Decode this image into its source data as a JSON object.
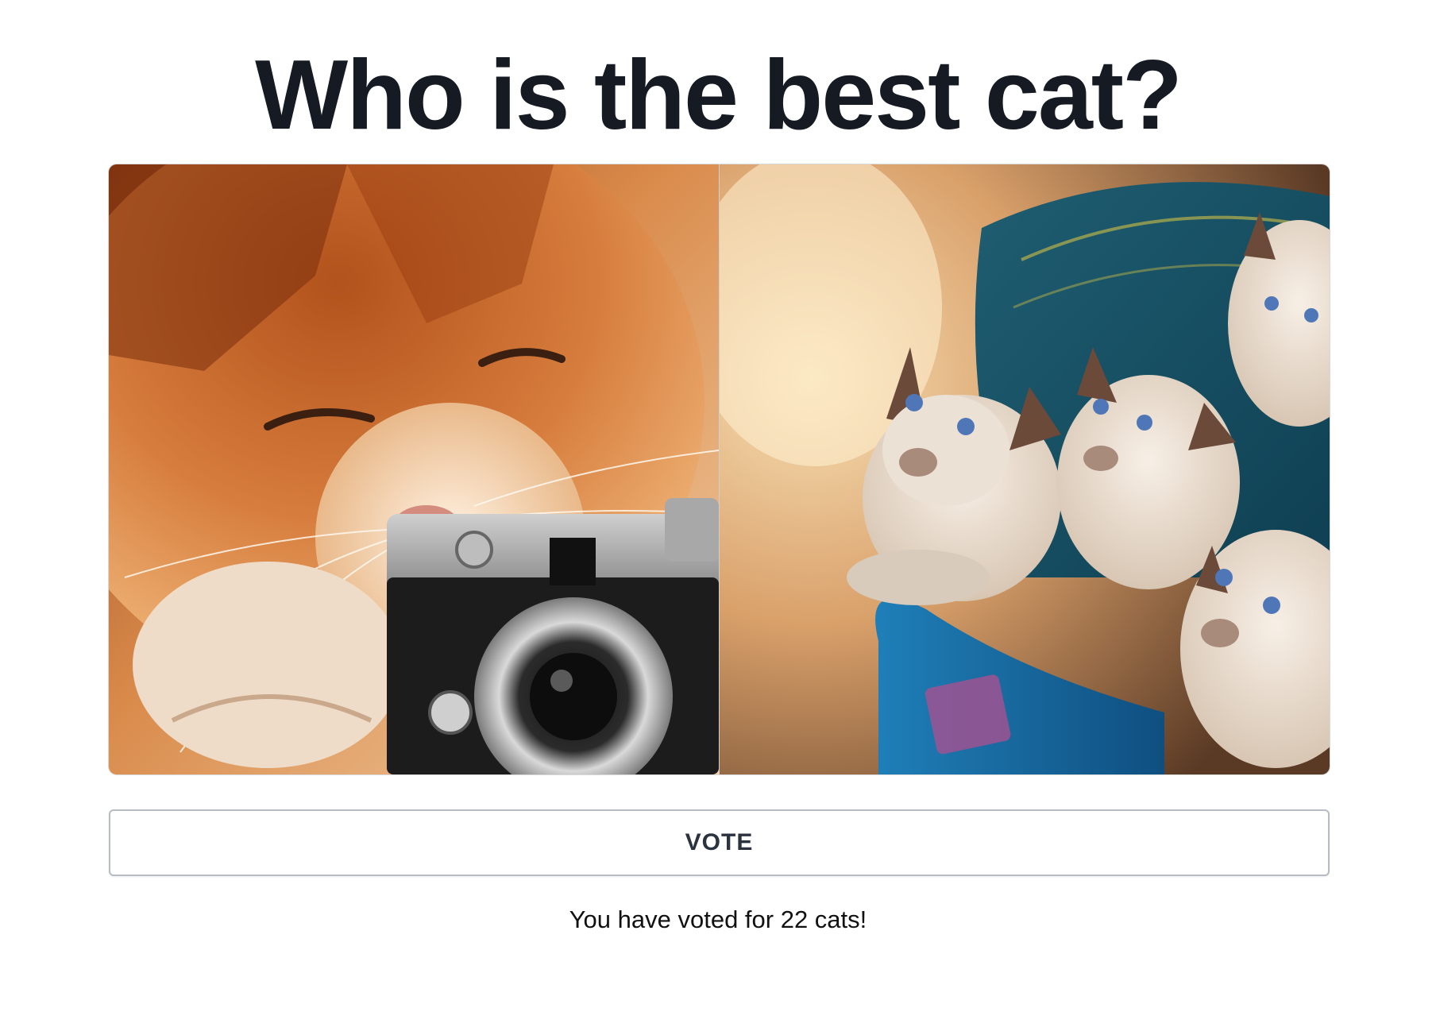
{
  "page": {
    "title": "Who is the best cat?"
  },
  "candidates": [
    {
      "name": "orange-kitten-with-camera"
    },
    {
      "name": "siamese-kittens-in-basket"
    }
  ],
  "vote": {
    "button_label": "VOTE",
    "status_text": "You have voted for 22 cats!"
  }
}
